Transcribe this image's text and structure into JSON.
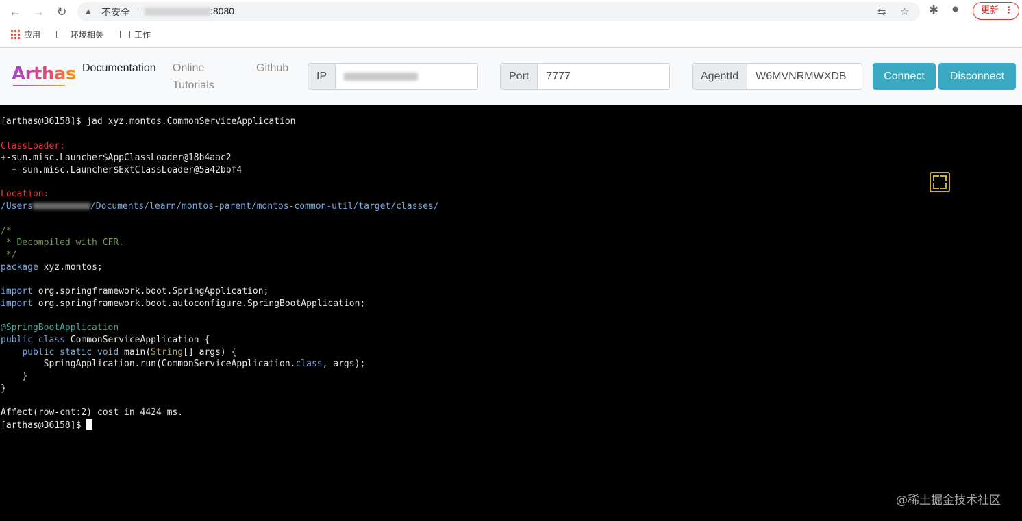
{
  "browser": {
    "insecure_label": "不安全",
    "url_suffix": ":8080",
    "update_label": "更新",
    "bookmarks": [
      {
        "label": "应用"
      },
      {
        "label": "环境相关"
      },
      {
        "label": "工作"
      }
    ]
  },
  "header": {
    "logo": "Arthas",
    "nav": {
      "documentation": "Documentation",
      "online_tutorials_1": "Online",
      "online_tutorials_2": "Tutorials",
      "github": "Github"
    },
    "ip_label": "IP",
    "ip_value": "",
    "port_label": "Port",
    "port_value": "7777",
    "agent_label": "AgentId",
    "agent_value": "W6MVNRMWXDB",
    "connect_label": "Connect",
    "disconnect_label": "Disconnect"
  },
  "terminal": {
    "prompt_cmd": "[arthas@36158]$ jad xyz.montos.CommonServiceApplication",
    "classloader_label": "ClassLoader:",
    "classloader_1": "+-sun.misc.Launcher$AppClassLoader@18b4aac2",
    "classloader_2": "  +-sun.misc.Launcher$ExtClassLoader@5a42bbf4",
    "location_label": "Location:",
    "location_prefix": "/Users",
    "location_suffix": "/Documents/learn/montos-parent/montos-common-util/target/classes/",
    "comment_1": "/*",
    "comment_2": " * Decompiled with CFR.",
    "comment_3": " */",
    "pkg_kw": "package",
    "pkg_name": " xyz.montos;",
    "import_kw": "import",
    "import_1": " org.springframework.boot.SpringApplication;",
    "import_2": " org.springframework.boot.autoconfigure.SpringBootApplication;",
    "annotation": "@SpringBootApplication",
    "class_kw": "public class",
    "class_name": " CommonServiceApplication {",
    "method_indent": "    ",
    "method_kw": "public static void",
    "method_name": " main(",
    "method_type": "String",
    "method_rest": "[] args) {",
    "body_prefix": "        SpringApplication.run(CommonServiceApplication.",
    "body_kw": "class",
    "body_suffix": ", args);",
    "close_1": "    }",
    "close_2": "}",
    "affect": "Affect(row-cnt:2) cost in 4424 ms.",
    "prompt_end": "[arthas@36158]$ "
  },
  "watermark": "@稀土掘金技术社区"
}
